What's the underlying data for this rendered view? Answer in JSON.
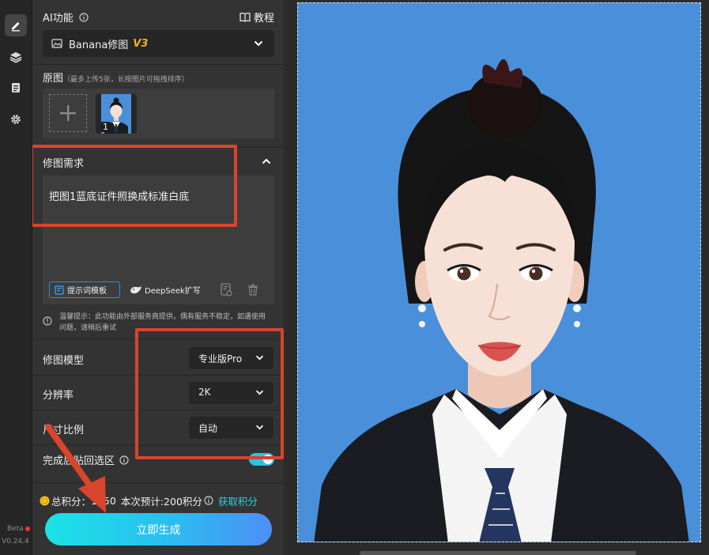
{
  "sidebar": {
    "version": "V0.24.4",
    "beta": "Beta",
    "icons": [
      "edit-icon",
      "layers-icon",
      "document-icon",
      "gear-icon"
    ]
  },
  "ai_feature": {
    "title": "AI功能",
    "tutorial": "教程",
    "selected_tool": "Banana修图",
    "selected_tool_version": "V3"
  },
  "original": {
    "title": "原图",
    "hint": "（最多上传5张，长按图片可拖拽排序）",
    "thumb_index": "1"
  },
  "request": {
    "title": "修图需求",
    "text": "把图1蓝底证件照换成标准白底",
    "template_button": "提示词模板",
    "deepseek_button": "DeepSeek扩写"
  },
  "notice": {
    "text": "温馨提示：此功能由外部服务商提供，偶有服务不稳定，如遇使用问题，请稍后重试"
  },
  "settings": {
    "model_label": "修图模型",
    "model_value": "专业版Pro",
    "resolution_label": "分辨率",
    "resolution_value": "2K",
    "ratio_label": "尺寸比例",
    "ratio_value": "自动",
    "paste_back_label": "完成后贴回选区",
    "paste_back_on": true
  },
  "footer": {
    "points_label": "总积分：",
    "points_value": "1050",
    "estimate": "本次预计:200积分",
    "get_points": "获取积分",
    "generate": "立即生成"
  },
  "colors": {
    "accent": "#2fd3e0",
    "annotation_red": "#d9442c",
    "photo_background": "#4a8fd9",
    "toggle_on": "#27c5e0"
  }
}
